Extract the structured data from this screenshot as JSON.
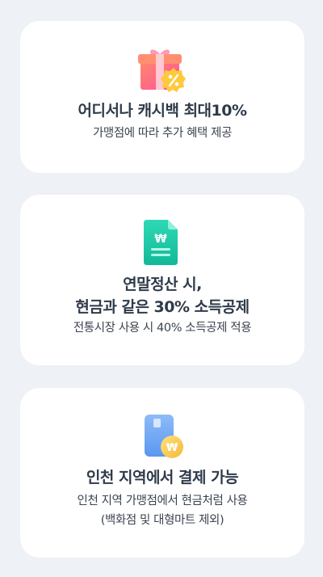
{
  "cards": [
    {
      "title": "어디서나 캐시백 최대10%",
      "description": "가맹점에 따라 추가 혜택 제공",
      "icon": "gift-percent-icon"
    },
    {
      "title_line1": "연말정산 시,",
      "title_line2": "현금과 같은 30% 소득공제",
      "description": "전통시장 사용 시 40% 소득공제 적용",
      "icon": "won-document-icon"
    },
    {
      "title": "인천 지역에서 결제 가능",
      "description_line1": "인천 지역 가맹점에서 현금처럼 사용",
      "description_line2": "(백화점 및 대형마트 제외)",
      "icon": "won-card-icon"
    }
  ],
  "colors": {
    "background": "#eef1f5",
    "card": "#ffffff",
    "text": "#2f3b4a",
    "gift_pink": "#ff6fa0",
    "badge_yellow": "#ffc93c",
    "doc_teal": "#1ccfa8",
    "card_blue": "#6aa6f5"
  }
}
